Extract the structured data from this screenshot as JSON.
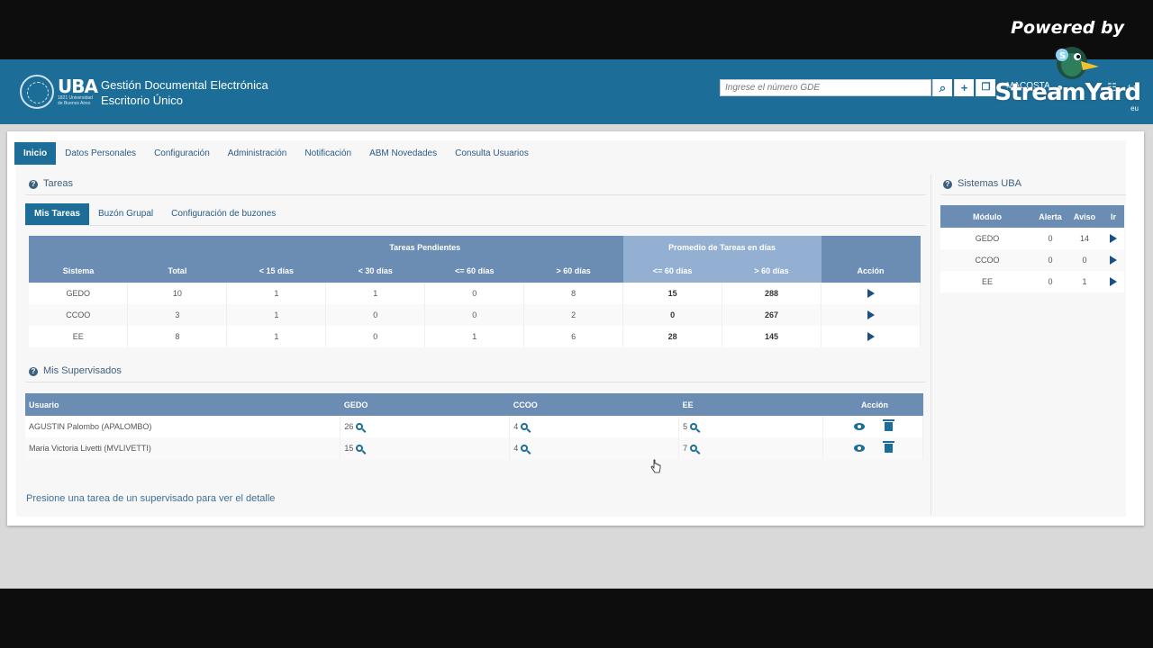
{
  "overlay": {
    "powered_by": "Powered by",
    "brand": "StreamYard",
    "brand_suffix": "eu"
  },
  "header": {
    "logo": "UBA",
    "logo_sub": "1821 Universidad de Buenos Aires",
    "app_title_line1": "Gestión Documental Electrónica",
    "app_title_line2": "Escritorio Único",
    "search_placeholder": "Ingrese el número GDE",
    "user": "MACOSTA"
  },
  "nav": [
    "Inicio",
    "Datos Personales",
    "Configuración",
    "Administración",
    "Notificación",
    "ABM Novedades",
    "Consulta Usuarios"
  ],
  "tareas": {
    "title": "Tareas",
    "tabs": [
      "Mis Tareas",
      "Buzón Grupal",
      "Configuración de buzones"
    ],
    "group_pendientes": "Tareas Pendientes",
    "group_promedio": "Promedio de Tareas en días",
    "columns": [
      "Sistema",
      "Total",
      "< 15 días",
      "< 30 días",
      "<= 60 días",
      "> 60 días",
      "<= 60 días",
      "> 60 días",
      "Acción"
    ],
    "rows": [
      [
        "GEDO",
        "10",
        "1",
        "1",
        "0",
        "8",
        "15",
        "288"
      ],
      [
        "CCOO",
        "3",
        "1",
        "0",
        "0",
        "2",
        "0",
        "267"
      ],
      [
        "EE",
        "8",
        "1",
        "0",
        "1",
        "6",
        "28",
        "145"
      ]
    ]
  },
  "supervisados": {
    "title": "Mis Supervisados",
    "columns": [
      "Usuario",
      "GEDO",
      "CCOO",
      "EE",
      "Acción"
    ],
    "rows": [
      [
        "AGUSTIN Palombo (APALOMBO)",
        "26",
        "4",
        "5"
      ],
      [
        "Maria Victoria Livetti (MVLIVETTI)",
        "15",
        "4",
        "7"
      ]
    ],
    "hint": "Presione una tarea de un supervisado para ver el detalle"
  },
  "sistemas": {
    "title": "Sistemas UBA",
    "columns": [
      "Módulo",
      "Alerta",
      "Aviso",
      "Ir"
    ],
    "rows": [
      [
        "GEDO",
        "0",
        "14"
      ],
      [
        "CCOO",
        "0",
        "0"
      ],
      [
        "EE",
        "0",
        "1"
      ]
    ]
  }
}
